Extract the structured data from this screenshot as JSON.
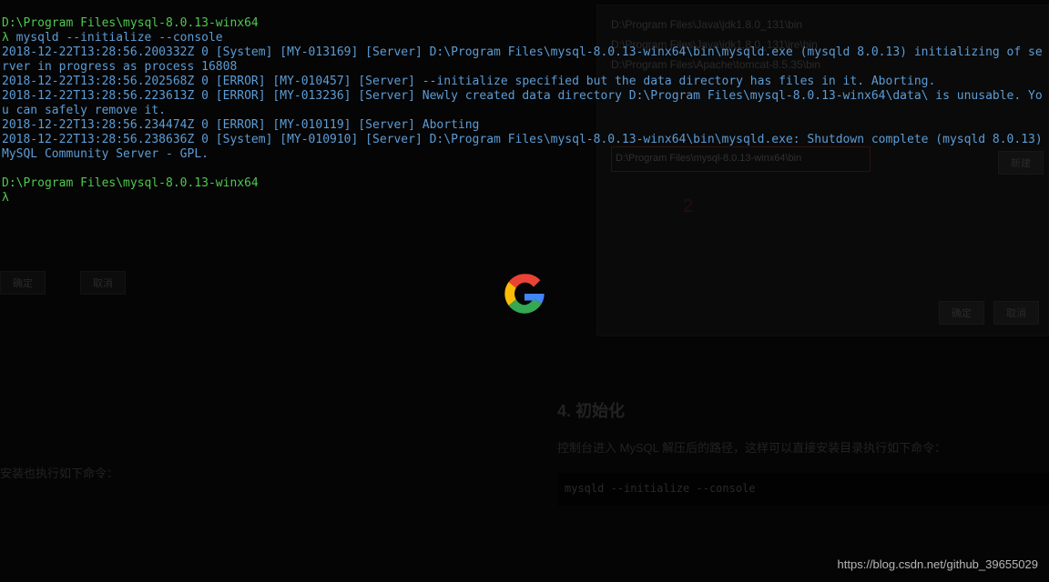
{
  "terminal": {
    "path1": "D:\\Program Files\\mysql-8.0.13-winx64",
    "lambda": "λ",
    "command": "mysqld --initialize --console",
    "lines": [
      "2018-12-22T13:28:56.200332Z 0 [System] [MY-013169] [Server] D:\\Program Files\\mysql-8.0.13-winx64\\bin\\mysqld.exe (mysqld 8.0.13) initializing of server in progress as process 16808",
      "2018-12-22T13:28:56.202568Z 0 [ERROR] [MY-010457] [Server] --initialize specified but the data directory has files in it. Aborting.",
      "2018-12-22T13:28:56.223613Z 0 [ERROR] [MY-013236] [Server] Newly created data directory D:\\Program Files\\mysql-8.0.13-winx64\\data\\ is unusable. You can safely remove it.",
      "2018-12-22T13:28:56.234474Z 0 [ERROR] [MY-010119] [Server] Aborting",
      "2018-12-22T13:28:56.238636Z 0 [System] [MY-010910] [Server] D:\\Program Files\\mysql-8.0.13-winx64\\bin\\mysqld.exe: Shutdown complete (mysqld 8.0.13)  MySQL Community Server - GPL."
    ],
    "path2": "D:\\Program Files\\mysql-8.0.13-winx64"
  },
  "background": {
    "paths": [
      "D:\\Program Files\\Java\\jdk1.8.0_131\\bin",
      "D:\\Program Files\\Java\\jdk1.8.0_131\\jre\\bin",
      "",
      "",
      "",
      "D:\\Program Files\\Apache\\tomcat-8.5.35\\bin",
      "",
      "D:\\Program Files\\mysql-8.0.13-winx64\\bin"
    ],
    "arrow2": "2",
    "section_title": "4. 初始化",
    "section_text": "控制台进入 MySQL 解压后的路径，这样可以直接安装目录执行如下命令：",
    "code_block": "mysqld --initialize --console",
    "left_text": "安装也执行如下命令：",
    "btn_ok": "确定",
    "btn_cancel": "取消",
    "btn_new": "新建"
  },
  "watermark": "https://blog.csdn.net/github_39655029"
}
